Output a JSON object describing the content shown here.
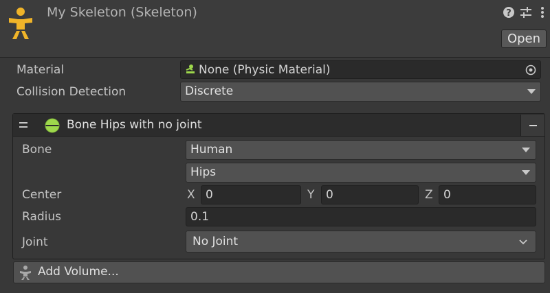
{
  "header": {
    "title": "My Skeleton (Skeleton)",
    "open_label": "Open",
    "app_icon": "skeleton-figure-icon",
    "help_icon": "question-circle-icon",
    "presets_icon": "sliders-icon",
    "menu_icon": "vertical-ellipsis-icon"
  },
  "material": {
    "label": "Material",
    "value": "None (Physic Material)",
    "icon": "physic-material-icon",
    "picker_icon": "object-picker-icon"
  },
  "collision": {
    "label": "Collision Detection",
    "value": "Discrete"
  },
  "bone_panel": {
    "title": "Bone Hips with no joint",
    "handle_icon": "drag-handle-icon",
    "icon": "sphere-icon",
    "collapse_icon": "minus-icon",
    "bone_label": "Bone",
    "bone_type": "Human",
    "bone_name": "Hips",
    "center_label": "Center",
    "center": {
      "x_label": "X",
      "x": "0",
      "y_label": "Y",
      "y": "0",
      "z_label": "Z",
      "z": "0"
    },
    "radius_label": "Radius",
    "radius": "0.1",
    "joint_label": "Joint",
    "joint": "No Joint"
  },
  "add_volume": {
    "label": "Add Volume...",
    "icon": "figure-add-icon"
  },
  "colors": {
    "accent_yellow": "#f0b429",
    "sphere_green": "#9ed84c",
    "background": "#383838"
  }
}
